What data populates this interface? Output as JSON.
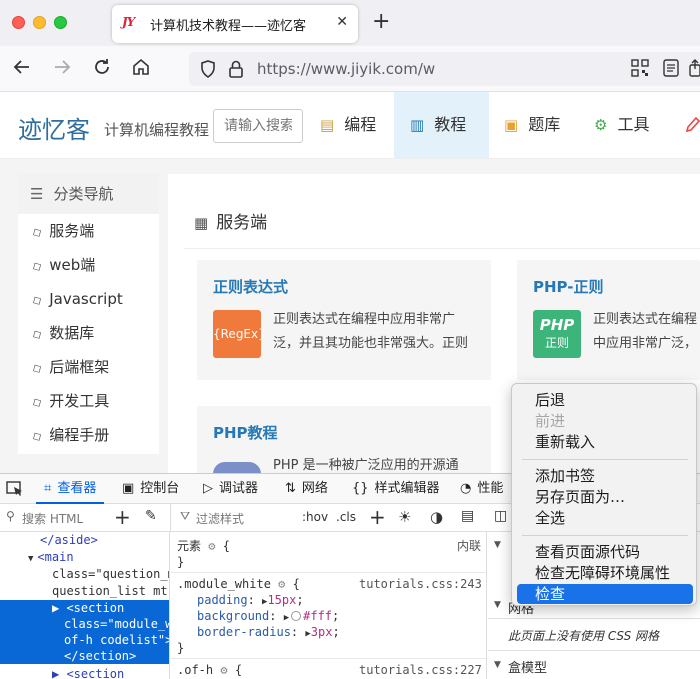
{
  "browser": {
    "tab": {
      "title": "计算机技术教程——迹忆客",
      "favicon": "JY",
      "close": "✕"
    },
    "new_tab": "+",
    "url": "https://www.jiyik.com/w",
    "icons": [
      "back-icon",
      "forward-icon",
      "reload-icon",
      "home-icon",
      "shield-icon",
      "lock-icon",
      "qr-code-icon",
      "reader-icon",
      "share-icon"
    ]
  },
  "site": {
    "logo": "迹忆客",
    "tagline": "计算机编程教程",
    "search_placeholder": "请输入搜索",
    "menu": [
      {
        "label": "编程",
        "icon": "▤"
      },
      {
        "label": "教程",
        "icon": "▥"
      },
      {
        "label": "题库",
        "icon": "▣"
      },
      {
        "label": "工具",
        "icon": "⚙"
      }
    ]
  },
  "sidebar": {
    "title": "分类导航",
    "items": [
      "服务端",
      "web端",
      "Javascript",
      "数据库",
      "后端框架",
      "开发工具",
      "编程手册"
    ]
  },
  "main": {
    "section_title": "服务端",
    "cards": [
      {
        "title": "正则表达式",
        "img_text": "{RegEx}",
        "desc": "正则表达式在编程中应用非常广泛，并且其功能也非常强大。正则"
      },
      {
        "title": "PHP-正则",
        "img_text": "PHP",
        "img_sub": "正则",
        "desc": "正则表达式在编程中应用非常广泛，其中php是基于"
      },
      {
        "title": "PHP教程",
        "desc": "PHP 是一种被广泛应用的开源通"
      }
    ]
  },
  "devtools": {
    "tabs": [
      "查看器",
      "控制台",
      "调试器",
      "网络",
      "样式编辑器",
      "性能"
    ],
    "search_placeholder": "搜索 HTML",
    "filter_placeholder": "过滤样式",
    "hov": ":hov",
    "cls": ".cls",
    "html_lines": [
      "</aside>",
      "<main",
      "class=\"question_m",
      "question_list mt",
      "▶ <section",
      "class=\"module_w",
      "of-h codelist\">",
      "</section>",
      "▶ <section",
      "class=\"module_"
    ],
    "rules": {
      "element_label": "元素",
      "element_brace": "{",
      "inline_label": "内联",
      "close_brace": "}",
      "module_white": {
        "selector": ".module_white",
        "source": "tutorials.css:243",
        "props": [
          {
            "name": "padding",
            "value": "15px"
          },
          {
            "name": "background",
            "value": "#fff"
          },
          {
            "name": "border-radius",
            "value": "3px"
          }
        ]
      },
      "of_h": {
        "selector": ".of-h",
        "source": "tutorials.css:227"
      }
    },
    "right_pane": {
      "grid_heading": "网格",
      "grid_empty": "此页面上没有使用 CSS 网格",
      "box_model_heading": "盒模型"
    }
  },
  "context_menu": {
    "items": [
      "后退",
      "前进",
      "重新载入",
      "添加书签",
      "另存页面为…",
      "全选",
      "查看页面源代码",
      "检查无障碍环境属性",
      "检查"
    ],
    "disabled": "前进",
    "active": "检查"
  },
  "colors": {
    "accent": "#0060df",
    "link": "#2679b5",
    "logo": "#2e6e9e",
    "menu_active_bg": "#e3f1fa",
    "selection": "#0a68d6",
    "context_active": "#1a72e8"
  }
}
